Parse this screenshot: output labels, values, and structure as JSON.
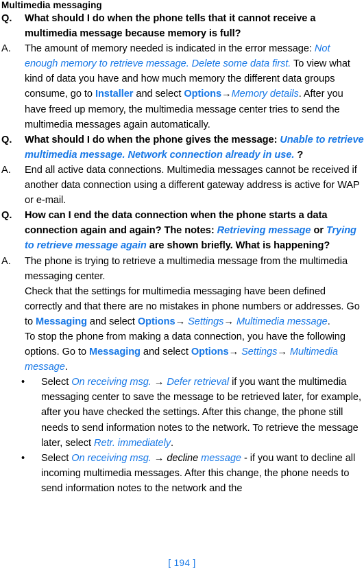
{
  "document": {
    "section_heading": "Multimedia messaging",
    "page_number": "[ 194 ]"
  },
  "labels": {
    "question": "Q.",
    "answer": "A.",
    "bullet": "•",
    "arrow": "→"
  },
  "entries": [
    {
      "type": "question",
      "label": "Q.",
      "runs": [
        {
          "style": "bold",
          "text": "What should I do when the phone tells that it cannot receive a multimedia message because memory is full?"
        }
      ]
    },
    {
      "type": "answer",
      "label": "A.",
      "runs": [
        {
          "style": "plain",
          "text": "The amount of memory needed is indicated in the error message: "
        },
        {
          "style": "italic-blue",
          "text": "Not enough memory to retrieve message. Delete some data first."
        },
        {
          "style": "plain",
          "text": "  To view what kind of data you have and how much memory the different data groups consume, go to "
        },
        {
          "style": "bold-blue",
          "text": "Installer"
        },
        {
          "style": "plain",
          "text": " and select "
        },
        {
          "style": "bold-blue",
          "text": "Options"
        },
        {
          "style": "arrow",
          "text": "→"
        },
        {
          "style": "italic-blue",
          "text": "Memory details"
        },
        {
          "style": "plain",
          "text": ". After you have freed up memory, the multimedia message center tries to send the multimedia messages again automatically."
        }
      ]
    },
    {
      "type": "question",
      "label": "Q.",
      "runs": [
        {
          "style": "bold",
          "text": "What should I do when the phone gives the message: "
        },
        {
          "style": "italic-blue",
          "text": "Unable to retrieve multimedia message. Network connection already in use."
        },
        {
          "style": "bold",
          "text": " ?"
        }
      ]
    },
    {
      "type": "answer",
      "label": "A.",
      "runs": [
        {
          "style": "plain",
          "text": "End all active data connections. Multimedia messages cannot be received if another data connection using a different gateway address is active for WAP or e-mail."
        }
      ]
    },
    {
      "type": "question",
      "label": "Q.",
      "runs": [
        {
          "style": "bold",
          "text": "How can I end the data connection when the phone starts a data connection again and again? The notes: "
        },
        {
          "style": "italic-blue",
          "text": "Retrieving message"
        },
        {
          "style": "bold",
          "text": " or "
        },
        {
          "style": "italic-blue",
          "text": "Trying to retrieve message again"
        },
        {
          "style": "bold",
          "text": " are shown briefly. What is happening?"
        }
      ]
    },
    {
      "type": "answer",
      "label": "A.",
      "runs": [
        {
          "style": "plain",
          "text": "The phone is trying to retrieve a multimedia message from the multimedia messaging center."
        }
      ]
    },
    {
      "type": "paragraph",
      "runs": [
        {
          "style": "plain",
          "text": "Check that the settings for multimedia messaging have been defined correctly and that there are no mistakes in phone numbers or addresses. Go to "
        },
        {
          "style": "bold-blue",
          "text": "Messaging"
        },
        {
          "style": "plain",
          "text": " and select "
        },
        {
          "style": "bold-blue",
          "text": "Options"
        },
        {
          "style": "arrow",
          "text": "→"
        },
        {
          "style": "plain",
          "text": " "
        },
        {
          "style": "italic-blue",
          "text": "Settings"
        },
        {
          "style": "arrow",
          "text": "→"
        },
        {
          "style": "plain",
          "text": " "
        },
        {
          "style": "italic-blue",
          "text": "Multimedia message"
        },
        {
          "style": "plain",
          "text": "."
        }
      ]
    },
    {
      "type": "paragraph",
      "runs": [
        {
          "style": "plain",
          "text": "To stop the phone from making a data connection, you have the following options. Go to "
        },
        {
          "style": "bold-blue",
          "text": "Messaging"
        },
        {
          "style": "plain",
          "text": " and select "
        },
        {
          "style": "bold-blue",
          "text": "Options"
        },
        {
          "style": "arrow",
          "text": "→"
        },
        {
          "style": "plain",
          "text": " "
        },
        {
          "style": "italic-blue",
          "text": "Settings"
        },
        {
          "style": "arrow",
          "text": "→"
        },
        {
          "style": "plain",
          "text": " "
        },
        {
          "style": "italic-blue",
          "text": "Multimedia message"
        },
        {
          "style": "plain",
          "text": "."
        }
      ]
    },
    {
      "type": "bullet",
      "label": "•",
      "runs": [
        {
          "style": "plain",
          "text": "Select "
        },
        {
          "style": "italic-blue",
          "text": "On receiving msg."
        },
        {
          "style": "plain",
          "text": " "
        },
        {
          "style": "arrow",
          "text": "→"
        },
        {
          "style": "plain",
          "text": " "
        },
        {
          "style": "italic-blue",
          "text": "Defer retrieval"
        },
        {
          "style": "plain",
          "text": " if you want the multimedia messaging center to save the message to be retrieved later, for example, after you have checked the settings. After this change, the phone still needs to send information notes to the network. To retrieve the message later, select "
        },
        {
          "style": "italic-blue",
          "text": "Retr. immediately"
        },
        {
          "style": "plain",
          "text": "."
        }
      ]
    },
    {
      "type": "bullet",
      "label": "•",
      "runs": [
        {
          "style": "plain",
          "text": "Select "
        },
        {
          "style": "italic-blue",
          "text": "On receiving msg."
        },
        {
          "style": "plain",
          "text": " "
        },
        {
          "style": "arrow",
          "text": "→"
        },
        {
          "style": "plain",
          "text": " "
        },
        {
          "style": "italic-black",
          "text": "decline"
        },
        {
          "style": "plain",
          "text": " "
        },
        {
          "style": "italic-blue",
          "text": "message"
        },
        {
          "style": "plain",
          "text": " - if you want to decline all incoming multimedia messages. After this change, the phone needs to send information notes to the network and the"
        }
      ]
    }
  ],
  "colors": {
    "link_blue": "#1878e6",
    "text_black": "#000000",
    "background": "#ffffff"
  }
}
